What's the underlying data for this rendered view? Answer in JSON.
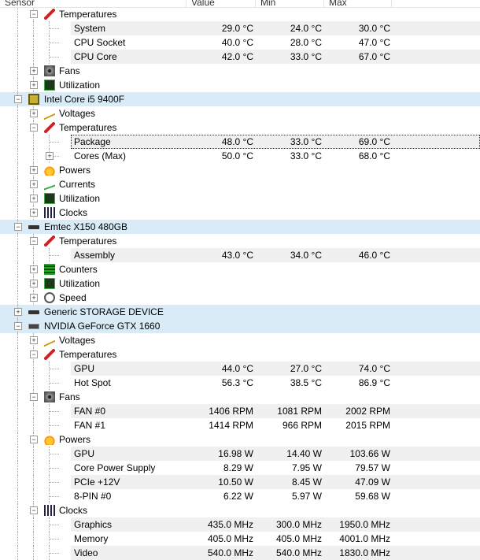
{
  "columns": [
    "Sensor",
    "Value",
    "Min",
    "Max"
  ],
  "rows": [
    {
      "lvl": 1,
      "exp": "-",
      "icon": "thermometer",
      "label": "Temperatures"
    },
    {
      "lvl": 2,
      "label": "System",
      "value": "29.0 °C",
      "min": "24.0 °C",
      "max": "30.0 °C"
    },
    {
      "lvl": 2,
      "label": "CPU Socket",
      "value": "40.0 °C",
      "min": "28.0 °C",
      "max": "47.0 °C"
    },
    {
      "lvl": 2,
      "label": "CPU Core",
      "value": "42.0 °C",
      "min": "33.0 °C",
      "max": "67.0 °C"
    },
    {
      "lvl": 1,
      "exp": "+",
      "icon": "fan",
      "label": "Fans"
    },
    {
      "lvl": 1,
      "exp": "+",
      "icon": "utilization",
      "label": "Utilization"
    },
    {
      "lvl": 0,
      "exp": "-",
      "icon": "cpu-chip",
      "label": "Intel Core i5 9400F"
    },
    {
      "lvl": 1,
      "exp": "+",
      "icon": "voltage",
      "label": "Voltages"
    },
    {
      "lvl": 1,
      "exp": "-",
      "icon": "thermometer",
      "label": "Temperatures"
    },
    {
      "lvl": 2,
      "label": "Package",
      "value": "48.0 °C",
      "min": "33.0 °C",
      "max": "69.0 °C",
      "selected": true
    },
    {
      "lvl": 2,
      "exp": "+",
      "label": "Cores (Max)",
      "value": "50.0 °C",
      "min": "33.0 °C",
      "max": "68.0 °C"
    },
    {
      "lvl": 1,
      "exp": "+",
      "icon": "power",
      "label": "Powers"
    },
    {
      "lvl": 1,
      "exp": "+",
      "icon": "current",
      "label": "Currents"
    },
    {
      "lvl": 1,
      "exp": "+",
      "icon": "utilization",
      "label": "Utilization"
    },
    {
      "lvl": 1,
      "exp": "+",
      "icon": "clock",
      "label": "Clocks"
    },
    {
      "lvl": 0,
      "exp": "-",
      "icon": "drive",
      "label": "Emtec X150 480GB"
    },
    {
      "lvl": 1,
      "exp": "-",
      "icon": "thermometer",
      "label": "Temperatures"
    },
    {
      "lvl": 2,
      "label": "Assembly",
      "value": "43.0 °C",
      "min": "34.0 °C",
      "max": "46.0 °C"
    },
    {
      "lvl": 1,
      "exp": "+",
      "icon": "counter",
      "label": "Counters"
    },
    {
      "lvl": 1,
      "exp": "+",
      "icon": "utilization",
      "label": "Utilization"
    },
    {
      "lvl": 1,
      "exp": "+",
      "icon": "speed",
      "label": "Speed"
    },
    {
      "lvl": 0,
      "exp": "+",
      "icon": "drive",
      "label": "Generic  STORAGE DEVICE"
    },
    {
      "lvl": 0,
      "exp": "-",
      "icon": "gpu",
      "label": "NVIDIA GeForce GTX 1660"
    },
    {
      "lvl": 1,
      "exp": "+",
      "icon": "voltage",
      "label": "Voltages"
    },
    {
      "lvl": 1,
      "exp": "-",
      "icon": "thermometer",
      "label": "Temperatures"
    },
    {
      "lvl": 2,
      "label": "GPU",
      "value": "44.0 °C",
      "min": "27.0 °C",
      "max": "74.0 °C"
    },
    {
      "lvl": 2,
      "label": "Hot Spot",
      "value": "56.3 °C",
      "min": "38.5 °C",
      "max": "86.9 °C"
    },
    {
      "lvl": 1,
      "exp": "-",
      "icon": "fan",
      "label": "Fans"
    },
    {
      "lvl": 2,
      "label": "FAN #0",
      "value": "1406 RPM",
      "min": "1081 RPM",
      "max": "2002 RPM"
    },
    {
      "lvl": 2,
      "label": "FAN #1",
      "value": "1414 RPM",
      "min": "966 RPM",
      "max": "2015 RPM"
    },
    {
      "lvl": 1,
      "exp": "-",
      "icon": "power",
      "label": "Powers"
    },
    {
      "lvl": 2,
      "label": "GPU",
      "value": "16.98 W",
      "min": "14.40 W",
      "max": "103.66 W"
    },
    {
      "lvl": 2,
      "label": "Core Power Supply",
      "value": "8.29 W",
      "min": "7.95 W",
      "max": "79.57 W"
    },
    {
      "lvl": 2,
      "label": "PCIe +12V",
      "value": "10.50 W",
      "min": "8.45 W",
      "max": "47.09 W"
    },
    {
      "lvl": 2,
      "label": "8-PIN #0",
      "value": "6.22 W",
      "min": "5.97 W",
      "max": "59.68 W"
    },
    {
      "lvl": 1,
      "exp": "-",
      "icon": "clock",
      "label": "Clocks"
    },
    {
      "lvl": 2,
      "label": "Graphics",
      "value": "435.0 MHz",
      "min": "300.0 MHz",
      "max": "1950.0 MHz"
    },
    {
      "lvl": 2,
      "label": "Memory",
      "value": "405.0 MHz",
      "min": "405.0 MHz",
      "max": "4001.0 MHz"
    },
    {
      "lvl": 2,
      "label": "Video",
      "value": "540.0 MHz",
      "min": "540.0 MHz",
      "max": "1830.0 MHz"
    }
  ]
}
